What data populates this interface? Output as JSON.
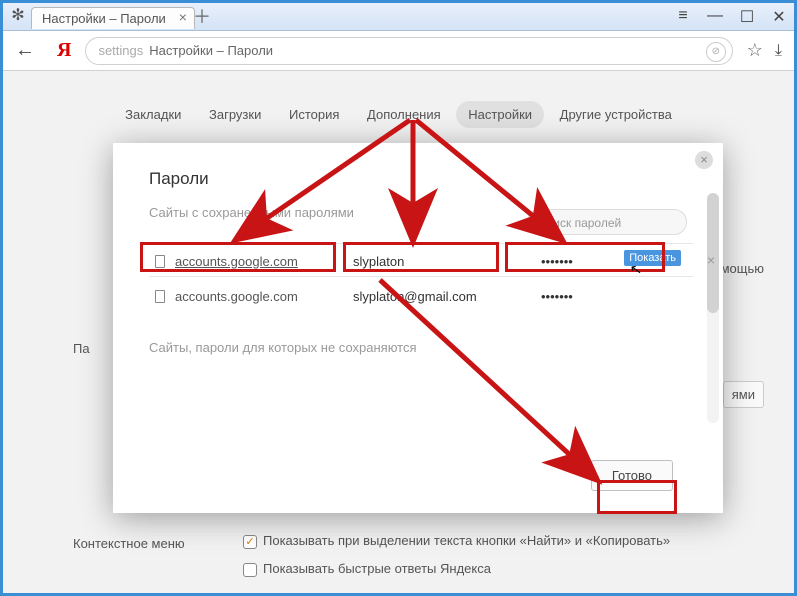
{
  "window": {
    "tab_title": "Настройки – Пароли",
    "omnibox_prefix": "settings",
    "omnibox_text": "Настройки – Пароли"
  },
  "nav": {
    "items": [
      "Закладки",
      "Загрузки",
      "История",
      "Дополнения",
      "Настройки",
      "Другие устройства"
    ],
    "active_index": 4
  },
  "modal": {
    "title": "Пароли",
    "saved_label": "Сайты с сохраненными паролями",
    "never_label": "Сайты, пароли для которых не сохраняются",
    "search_placeholder": "Поиск паролей",
    "rows": [
      {
        "site": "accounts.google.com",
        "user": "slyplaton",
        "pass": "•••••••",
        "show": "Показать"
      },
      {
        "site": "accounts.google.com",
        "user": "slyplaton@gmail.com",
        "pass": "•••••••"
      }
    ],
    "done": "Готово"
  },
  "background": {
    "right_snippet1": "помощью",
    "right_snippet2": "ями",
    "left_pa": "Па",
    "context_menu": "Контекстное меню",
    "cb1": "Показывать при выделении текста кнопки «Найти» и «Копировать»",
    "cb2": "Показывать быстрые ответы Яндекса"
  }
}
